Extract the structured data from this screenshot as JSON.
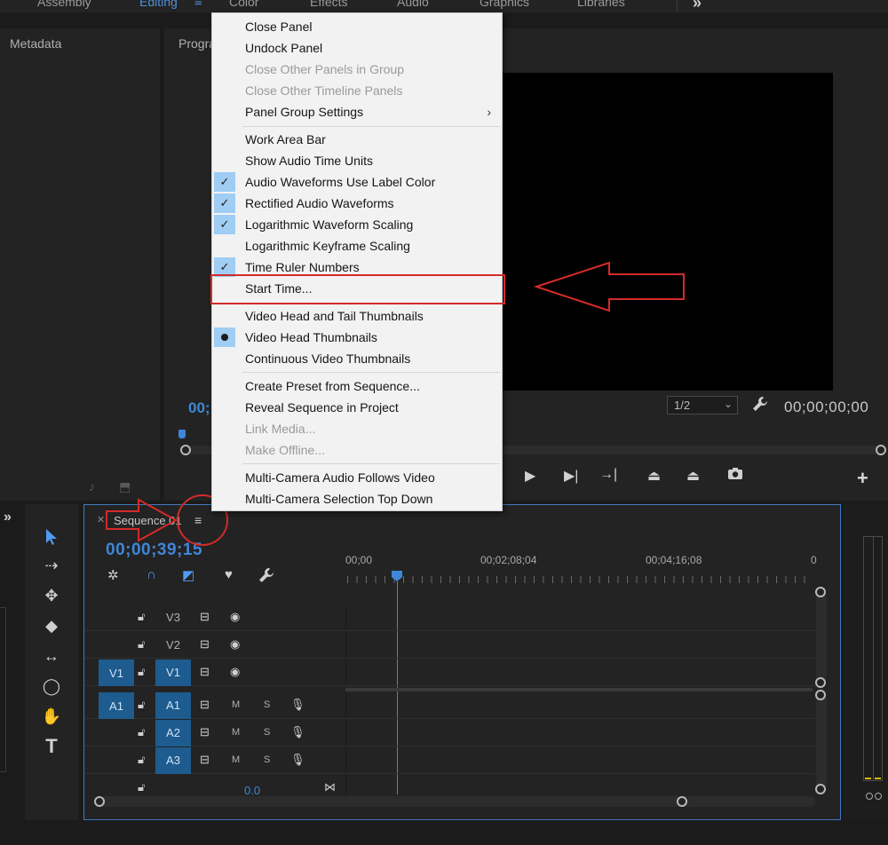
{
  "workspace_tabs": [
    "Assembly",
    "Editing",
    "Color",
    "Effects",
    "Audio",
    "Graphics",
    "Libraries"
  ],
  "workspace_menu_icon": "≡",
  "more_icon": "»",
  "panels": {
    "metadata_title": "Metadata",
    "program_title": "Program",
    "program_left_timecode": "00;",
    "program_right_timecode": "00;00;00;00",
    "resolution": "1/2"
  },
  "timeline": {
    "sequence_tab": "Sequence 01",
    "timecode": "00;00;39;15",
    "ruler_labels": [
      "00;00",
      "00;02;08;04",
      "00;04;16;08",
      "0"
    ],
    "video_tracks": [
      {
        "name": "V3",
        "patch": ""
      },
      {
        "name": "V2",
        "patch": ""
      },
      {
        "name": "V1",
        "patch": "V1"
      }
    ],
    "audio_tracks": [
      {
        "name": "A1",
        "patch": "A1"
      },
      {
        "name": "A2",
        "patch": ""
      },
      {
        "name": "A3",
        "patch": ""
      }
    ],
    "mute_label": "M",
    "solo_label": "S",
    "master_value": "0.0"
  },
  "menu": {
    "items": [
      {
        "label": "Close Panel",
        "state": "enabled"
      },
      {
        "label": "Undock Panel",
        "state": "enabled"
      },
      {
        "label": "Close Other Panels in Group",
        "state": "disabled"
      },
      {
        "label": "Close Other Timeline Panels",
        "state": "disabled"
      },
      {
        "label": "Panel Group Settings",
        "state": "submenu"
      },
      {
        "label": "Work Area Bar",
        "state": "enabled"
      },
      {
        "label": "Show Audio Time Units",
        "state": "enabled"
      },
      {
        "label": "Audio Waveforms Use Label Color",
        "state": "checked"
      },
      {
        "label": "Rectified Audio Waveforms",
        "state": "checked"
      },
      {
        "label": "Logarithmic Waveform Scaling",
        "state": "checked"
      },
      {
        "label": "Logarithmic Keyframe Scaling",
        "state": "enabled"
      },
      {
        "label": "Time Ruler Numbers",
        "state": "checked"
      },
      {
        "label": "Start Time...",
        "state": "highlighted"
      },
      {
        "label": "Video Head and Tail Thumbnails",
        "state": "enabled"
      },
      {
        "label": "Video Head Thumbnails",
        "state": "selected"
      },
      {
        "label": "Continuous Video Thumbnails",
        "state": "enabled"
      },
      {
        "label": "Create Preset from Sequence...",
        "state": "enabled"
      },
      {
        "label": "Reveal Sequence in Project",
        "state": "enabled"
      },
      {
        "label": "Link Media...",
        "state": "disabled"
      },
      {
        "label": "Make Offline...",
        "state": "disabled"
      },
      {
        "label": "Multi-Camera Audio Follows Video",
        "state": "enabled"
      },
      {
        "label": "Multi-Camera Selection Top Down",
        "state": "enabled"
      }
    ]
  },
  "colors": {
    "accent_blue": "#3f86d8",
    "annotation_red": "#d42a2a",
    "menu_bg": "#f2f2f2",
    "check_bg": "#9fcdf3"
  }
}
